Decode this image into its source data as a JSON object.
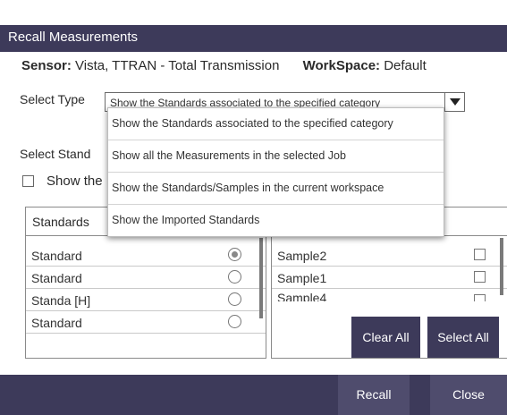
{
  "dialog": {
    "title": "Recall Measurements",
    "sensor_label": "Sensor:",
    "sensor_value": "Vista, TTRAN - Total Transmission",
    "workspace_label": "WorkSpace:",
    "workspace_value": "Default"
  },
  "select_type": {
    "label": "Select Type",
    "selected": "Show the Standards associated to the specified category",
    "options": [
      "Show the Standards associated to the specified category",
      "Show all the Measurements in the selected Job",
      "Show the Standards/Samples in the current workspace",
      "Show the Imported Standards"
    ]
  },
  "select_standard": {
    "label": "Select Stand"
  },
  "show_checkbox": {
    "label": "Show the",
    "checked": false
  },
  "standards_panel": {
    "header": "Standards",
    "rows": [
      {
        "name": "Standard",
        "selected": true
      },
      {
        "name": "Standard",
        "selected": false
      },
      {
        "name": "Standa [H]",
        "selected": false
      },
      {
        "name": "Standard",
        "selected": false
      }
    ]
  },
  "samples_panel": {
    "rows": [
      {
        "name": "Sample2",
        "checked": false
      },
      {
        "name": "Sample1",
        "checked": false
      },
      {
        "name": "Sample4",
        "checked": false
      }
    ],
    "clear_all_label": "Clear All",
    "select_all_label": "Select All"
  },
  "footer": {
    "recall_label": "Recall",
    "close_label": "Close"
  },
  "colors": {
    "accent": "#3d3a5a",
    "footer_button": "#4f4c6d"
  }
}
